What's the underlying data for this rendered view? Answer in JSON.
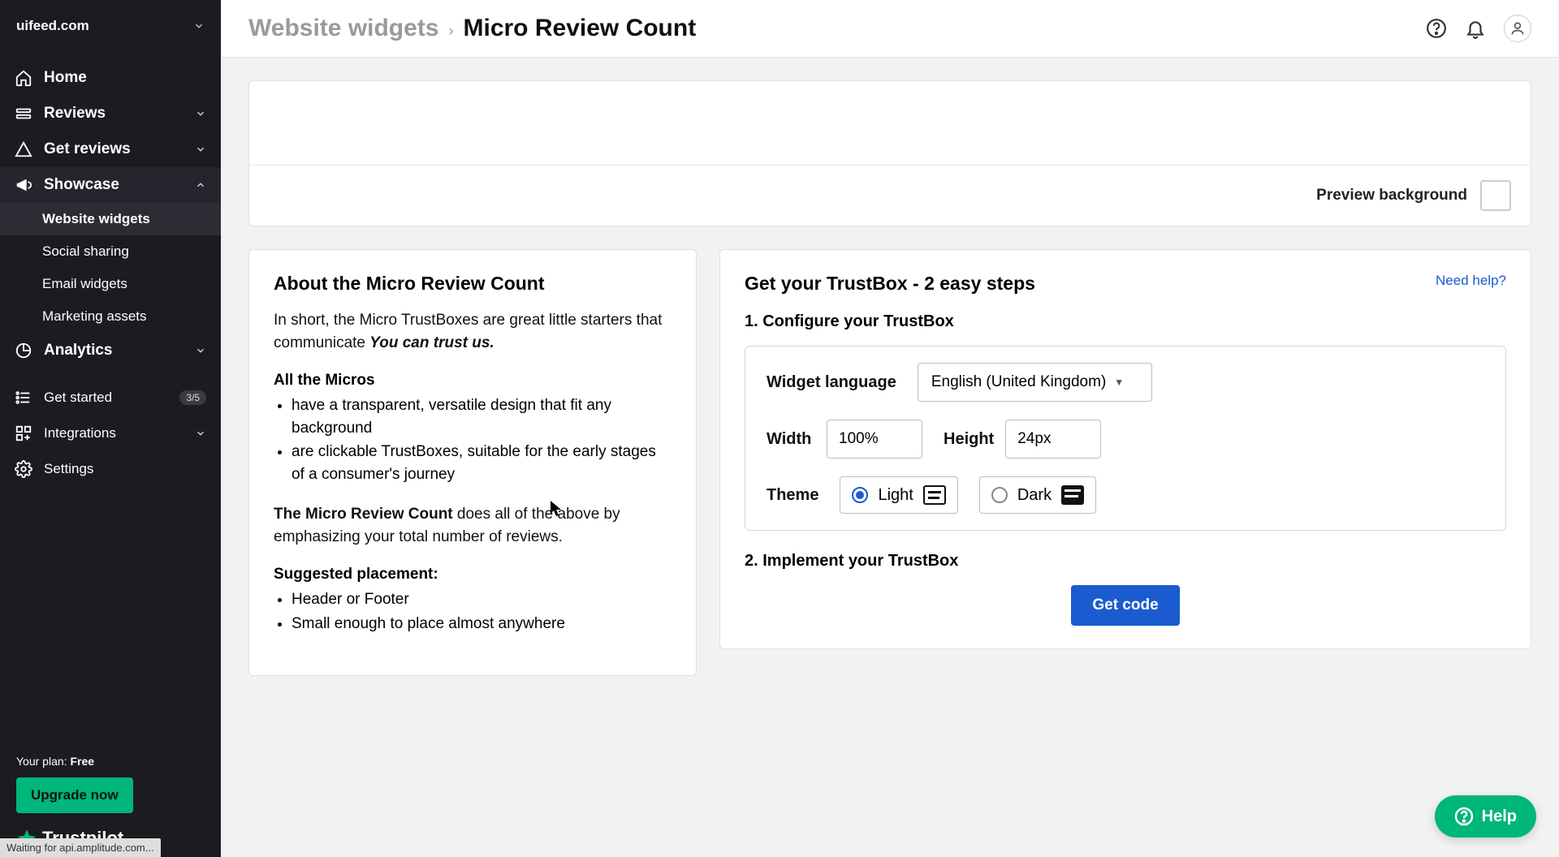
{
  "site_name": "uifeed.com",
  "nav": {
    "home": "Home",
    "reviews": "Reviews",
    "get_reviews": "Get reviews",
    "showcase": "Showcase",
    "showcase_items": {
      "website_widgets": "Website widgets",
      "social_sharing": "Social sharing",
      "email_widgets": "Email widgets",
      "marketing_assets": "Marketing assets"
    },
    "analytics": "Analytics",
    "get_started": "Get started",
    "get_started_badge": "3/5",
    "integrations": "Integrations",
    "settings": "Settings"
  },
  "plan": {
    "label": "Your plan: ",
    "value": "Free"
  },
  "upgrade_label": "Upgrade now",
  "brand_name": "Trustpilot",
  "status_text": "Waiting for api.amplitude.com...",
  "breadcrumb": {
    "parent": "Website widgets",
    "current": "Micro Review Count"
  },
  "preview": {
    "label": "Preview background"
  },
  "about": {
    "heading": "About the Micro Review Count",
    "intro_pre": "In short, the Micro TrustBoxes are great little starters that communicate ",
    "intro_emph": "You can trust us.",
    "micros_heading": "All the Micros",
    "micros_bullets": [
      "have a transparent, versatile design that fit any background",
      "are clickable TrustBoxes, suitable for the early stages of a consumer's journey"
    ],
    "mrc_strong": "The Micro Review Count",
    "mrc_rest": " does all of the above by emphasizing your total number of reviews.",
    "placement_heading": "Suggested placement:",
    "placement_bullets": [
      "Header or Footer",
      "Small enough to place almost anywhere"
    ]
  },
  "config": {
    "heading": "Get your TrustBox - 2 easy steps",
    "help_link": "Need help?",
    "step1": "1. Configure your TrustBox",
    "widget_language_label": "Widget language",
    "widget_language_value": "English (United Kingdom)",
    "width_label": "Width",
    "width_value": "100%",
    "height_label": "Height",
    "height_value": "24px",
    "theme_label": "Theme",
    "theme_light": "Light",
    "theme_dark": "Dark",
    "step2": "2. Implement your TrustBox",
    "get_code": "Get code"
  },
  "help_fab": "Help"
}
